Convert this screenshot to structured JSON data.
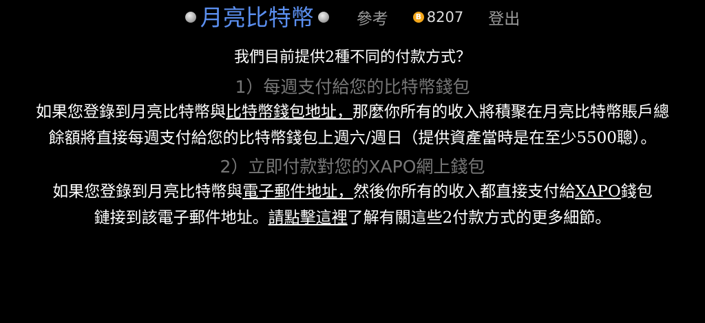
{
  "header": {
    "brand": "月亮比特幣",
    "nav_reference": "參考",
    "balance": "8207",
    "coin_symbol": "B",
    "nav_logout": "登出"
  },
  "main": {
    "question": "我們目前提供2種不同的付款方式？",
    "option1": {
      "heading": "1）每週支付給您的比特幣錢包",
      "text_a": "如果您登錄到月亮比特幣與",
      "link": "比特幣錢包地址，",
      "text_b": "那麼你所有的收入將積聚在月亮比特幣賬戶總餘額將直接每週支付給您的比特幣錢包上週六/週日（提供資產當時是在至少5500聰）。"
    },
    "option2": {
      "heading": "2）立即付款對您的XAPO網上錢包",
      "text_a": "如果您登錄到月亮比特幣與",
      "link_email": "電子郵件地址，",
      "text_b": "然後你所有的收入都直接支付給",
      "link_xapo": "XAPO",
      "text_c": "錢包鏈接到該電子郵件地址。",
      "link_details": "請點擊這裡",
      "text_d": "了解有關這些2付款方式的更多細節。"
    }
  },
  "colors": {
    "background": "#000000",
    "brand": "#5b8ff0",
    "muted": "#777777",
    "coin": "#f3a71b"
  }
}
